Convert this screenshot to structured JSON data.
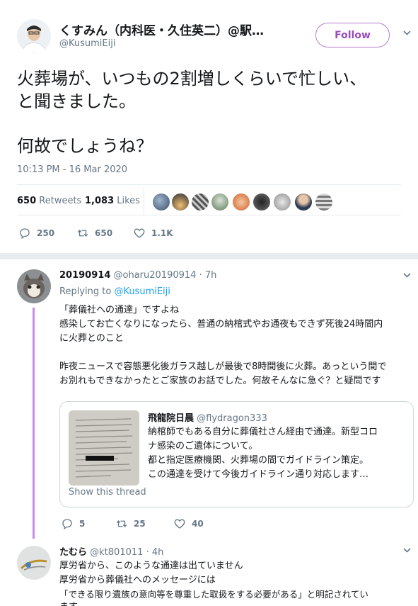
{
  "main_tweet": {
    "author_name": "くすみん（内科医・久住英二）@駅…",
    "author_handle": "@KusumiEiji",
    "follow_label": "Follow",
    "text_line1": "火葬場が、いつもの2割増しくらいで忙しい、",
    "text_line2": "と聞きました。",
    "text_line3": "何故でしょうね？",
    "timestamp": "10:13 PM - 16 Mar 2020",
    "retweets_count": "650",
    "retweets_label": "Retweets",
    "likes_count": "1,083",
    "likes_label": "Likes",
    "reply_count": "250",
    "retweet_count": "650",
    "like_count": "1.1K"
  },
  "reply1": {
    "author_name": "20190914",
    "author_handle": "@oharu20190914",
    "time": "· 7h",
    "replying_prefix": "Replying to",
    "replying_to": "@KusumiEiji",
    "line1": "「葬儀社への通達」ですよね",
    "line2": "感染してお亡くなりになったら、普通の納棺式やお通夜もできず死後24時間内",
    "line3": "に火葬とのこと",
    "line4": "昨夜ニュースで容態悪化後ガラス越しが最後で8時間後に火葬。あっという間で",
    "line5": "お別れもできなかったとご家族のお話でした。何故そんなに急ぐ？と疑問です",
    "quote": {
      "author_name": "飛龍院日晨",
      "author_handle": "@flydragon333",
      "line1": "納棺師でもある自分に葬儀社さん経由で通達。新型コロ",
      "line2": "ナ感染のご遺体について。",
      "line3": "都と指定医療機関、火葬場の間でガイドライン策定。",
      "line4": "この通達を受けて今後ガイドライン通り対応します…",
      "show_thread": "Show this thread"
    },
    "reply_count": "5",
    "retweet_count": "25",
    "like_count": "40"
  },
  "reply2": {
    "author_name": "たむら",
    "author_handle": "@kt801011",
    "time": "· 4h",
    "line1": "厚労省から、このような通達は出ていません",
    "line2": "厚労省から葬儀社へのメッセージには",
    "line3": "「できる限り遺族の意向等を尊重した取扱をする必要がある」と明記されてい",
    "line4": "ます"
  },
  "colors": {
    "follow_purple": "#9b4dbd",
    "thread_line": "#c58de0",
    "link": "#1da1f2",
    "muted": "#657786"
  }
}
